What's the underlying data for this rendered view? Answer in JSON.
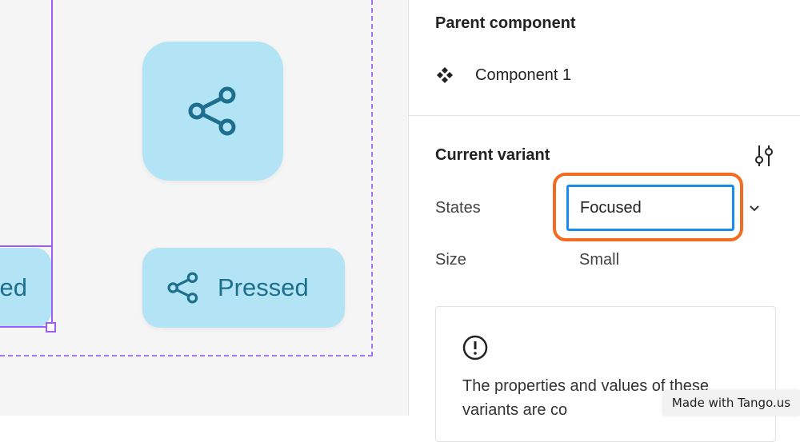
{
  "canvas": {
    "left_variant_label": "ed",
    "pressed_label": "Pressed",
    "share_icon": "share-icon",
    "tile_color": "#b2e4f6",
    "selection_color": "#9d5cf5"
  },
  "panel": {
    "parent_component": {
      "title": "Parent component",
      "component_icon": "component-icon",
      "component_name": "Component 1"
    },
    "current_variant": {
      "title": "Current variant",
      "settings_icon": "tune-icon",
      "properties": [
        {
          "label": "States",
          "value": "Focused"
        },
        {
          "label": "Size",
          "value": "Small"
        }
      ]
    },
    "info": {
      "icon": "info-icon",
      "text": "The properties and values of these variants are co"
    }
  },
  "watermark": "Made with Tango.us",
  "colors": {
    "highlight": "#f26b21",
    "focus_ring": "#1a8cf0"
  }
}
